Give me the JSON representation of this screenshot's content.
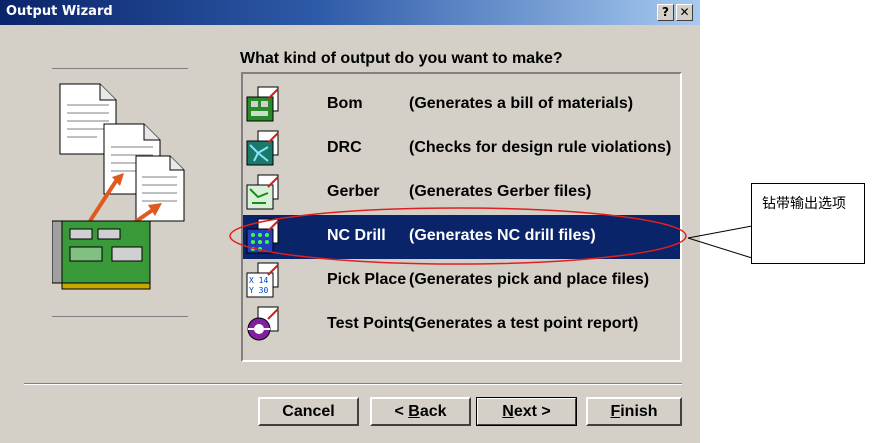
{
  "window": {
    "title": "Output Wizard",
    "help_glyph": "?",
    "close_glyph": "✕"
  },
  "wizard": {
    "question": "What kind of output do you want to make?",
    "items": [
      {
        "name": "Bom",
        "description": "(Generates a bill of materials)",
        "icon": "bom-icon",
        "selected": false
      },
      {
        "name": "DRC",
        "description": "(Checks for design rule violations)",
        "icon": "drc-icon",
        "selected": false
      },
      {
        "name": "Gerber",
        "description": "(Generates Gerber files)",
        "icon": "gerber-icon",
        "selected": false
      },
      {
        "name": "NC Drill",
        "description": "(Generates NC drill files)",
        "icon": "nc-drill-icon",
        "selected": true
      },
      {
        "name": "Pick Place",
        "description": "(Generates pick and place files)",
        "icon": "pick-place-icon",
        "selected": false
      },
      {
        "name": "Test Points",
        "description": "(Generates a test point report)",
        "icon": "test-points-icon",
        "selected": false
      }
    ]
  },
  "buttons": {
    "cancel": "Cancel",
    "back_prefix": "< ",
    "back_key": "B",
    "back_rest": "ack",
    "next_key": "N",
    "next_rest": "ext >",
    "finish_key": "F",
    "finish_rest": "inish"
  },
  "annotation": {
    "callout_text": "钻带输出选项"
  },
  "colors": {
    "dialog_face": "#d4d0c8",
    "title_start": "#0a246a",
    "selection": "#0a246a",
    "ellipse": "#e02020"
  }
}
